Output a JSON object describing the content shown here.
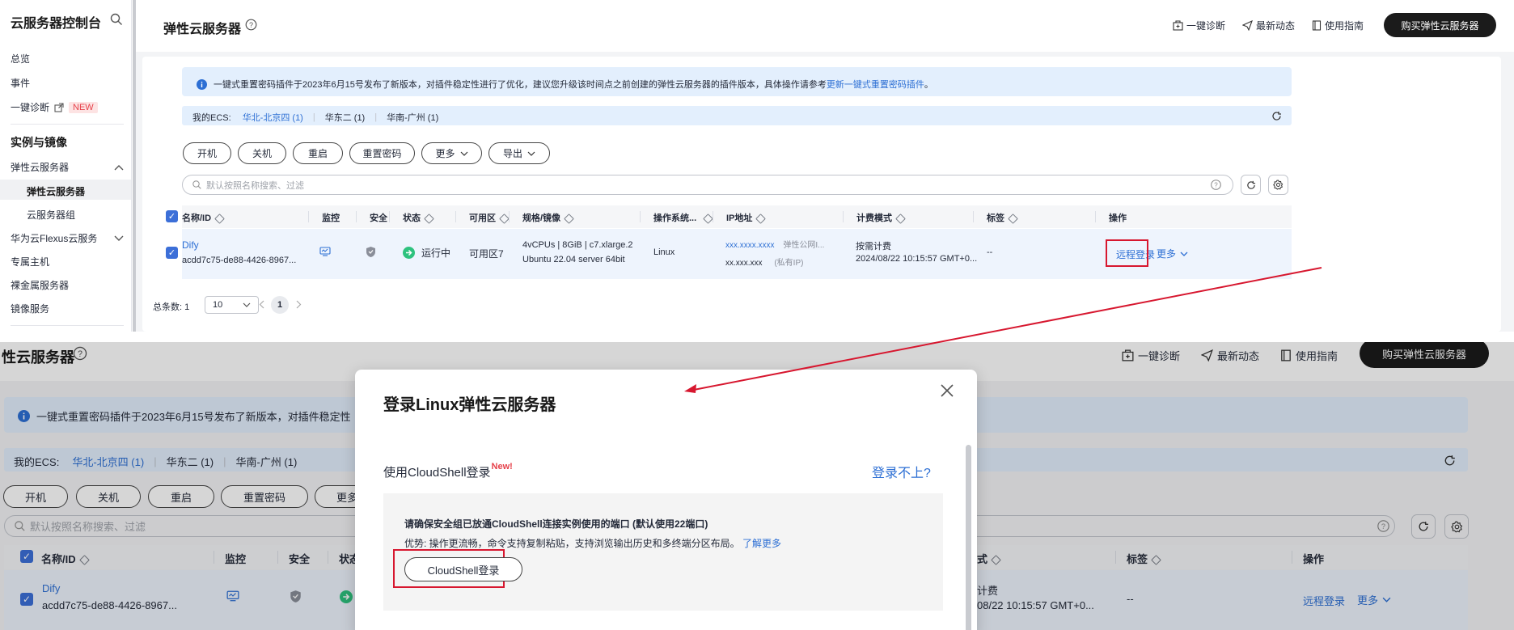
{
  "sidebar": {
    "title": "云服务器控制台",
    "items": [
      {
        "label": "总览"
      },
      {
        "label": "事件"
      },
      {
        "label": "一键诊断",
        "badge": "NEW"
      }
    ],
    "section_title": "实例与镜像",
    "group_label": "弹性云服务器",
    "sub_items": [
      {
        "label": "弹性云服务器"
      },
      {
        "label": "云服务器组"
      }
    ],
    "more_items": [
      {
        "label": "华为云Flexus云服务"
      },
      {
        "label": "专属主机"
      },
      {
        "label": "裸金属服务器"
      },
      {
        "label": "镜像服务"
      }
    ]
  },
  "header": {
    "title": "弹性云服务器",
    "links": [
      "一键诊断",
      "最新动态",
      "使用指南"
    ],
    "buy_label": "购买弹性云服务器"
  },
  "notice": {
    "text": "一键式重置密码插件于2023年6月15号发布了新版本，对插件稳定性进行了优化，建议您升级该时间点之前创建的弹性云服务器的插件版本，具体操作请参考",
    "link": "更新一键式重置密码插件",
    "end": "。",
    "bottom_text": "一键式重置密码插件于2023年6月15号发布了新版本，对插件稳定性"
  },
  "regions": {
    "label": "我的ECS:",
    "items": [
      "华北-北京四 (1)",
      "华东二 (1)",
      "华南-广州 (1)"
    ]
  },
  "actions": [
    "开机",
    "关机",
    "重启",
    "重置密码",
    "更多",
    "导出"
  ],
  "bottom_more_partial": "更多",
  "search": {
    "placeholder": "默认按照名称搜索、过滤"
  },
  "table": {
    "columns": [
      "名称/ID",
      "监控",
      "安全",
      "状态",
      "可用区",
      "规格/镜像",
      "操作系统...",
      "IP地址",
      "计费模式",
      "标签",
      "操作"
    ],
    "bottom_columns": [
      "名称/ID",
      "监控",
      "安全",
      "状态",
      "式",
      "标签",
      "操作"
    ],
    "row": {
      "name": "Dify",
      "id": "acdd7c75-de88-4426-8967...",
      "status": "运行中",
      "zone": "可用区7",
      "spec": "4vCPUs | 8GiB | c7.xlarge.2",
      "image": "Ubuntu 22.04 server 64bit",
      "os": "Linux",
      "ip_public": "xxx.xxxx.xxxx",
      "ip_public_note": "弹性公网I...",
      "ip_private": "xx.xxx.xxx",
      "ip_private_note": "(私有IP)",
      "billing": "按需计费",
      "billing_time": "2024/08/22 10:15:57 GMT+0...",
      "billing_partial": "计费",
      "billing_time_partial": "08/22 10:15:57 GMT+0...",
      "tags": "--",
      "op_login": "远程登录",
      "op_more": "更多"
    }
  },
  "pagination": {
    "total_label": "总条数: 1",
    "page_size": "10",
    "current": "1"
  },
  "bottom_title_partial": "性云服务器",
  "modal": {
    "title": "登录Linux弹性云服务器",
    "method_label": "使用CloudShell登录",
    "new_badge": "New!",
    "cant_login": "登录不上?",
    "notice_title": "请确保安全组已放通CloudShell连接实例使用的端口 (默认使用22端口)",
    "advantage_text": "优势: 操作更流畅，命令支持复制粘贴，支持浏览输出历史和多终端分区布局。",
    "learn_more": "了解更多",
    "cloudshell_button": "CloudShell登录"
  },
  "colors": {
    "accent": "#2d6fd4",
    "checkbox": "#3c6fd8",
    "highlight_box": "#d7172f",
    "notice_bg": "#e3effd",
    "dark_button": "#1b1b1b",
    "status_green": "#2ec27e",
    "new_badge": "#e6424b"
  }
}
